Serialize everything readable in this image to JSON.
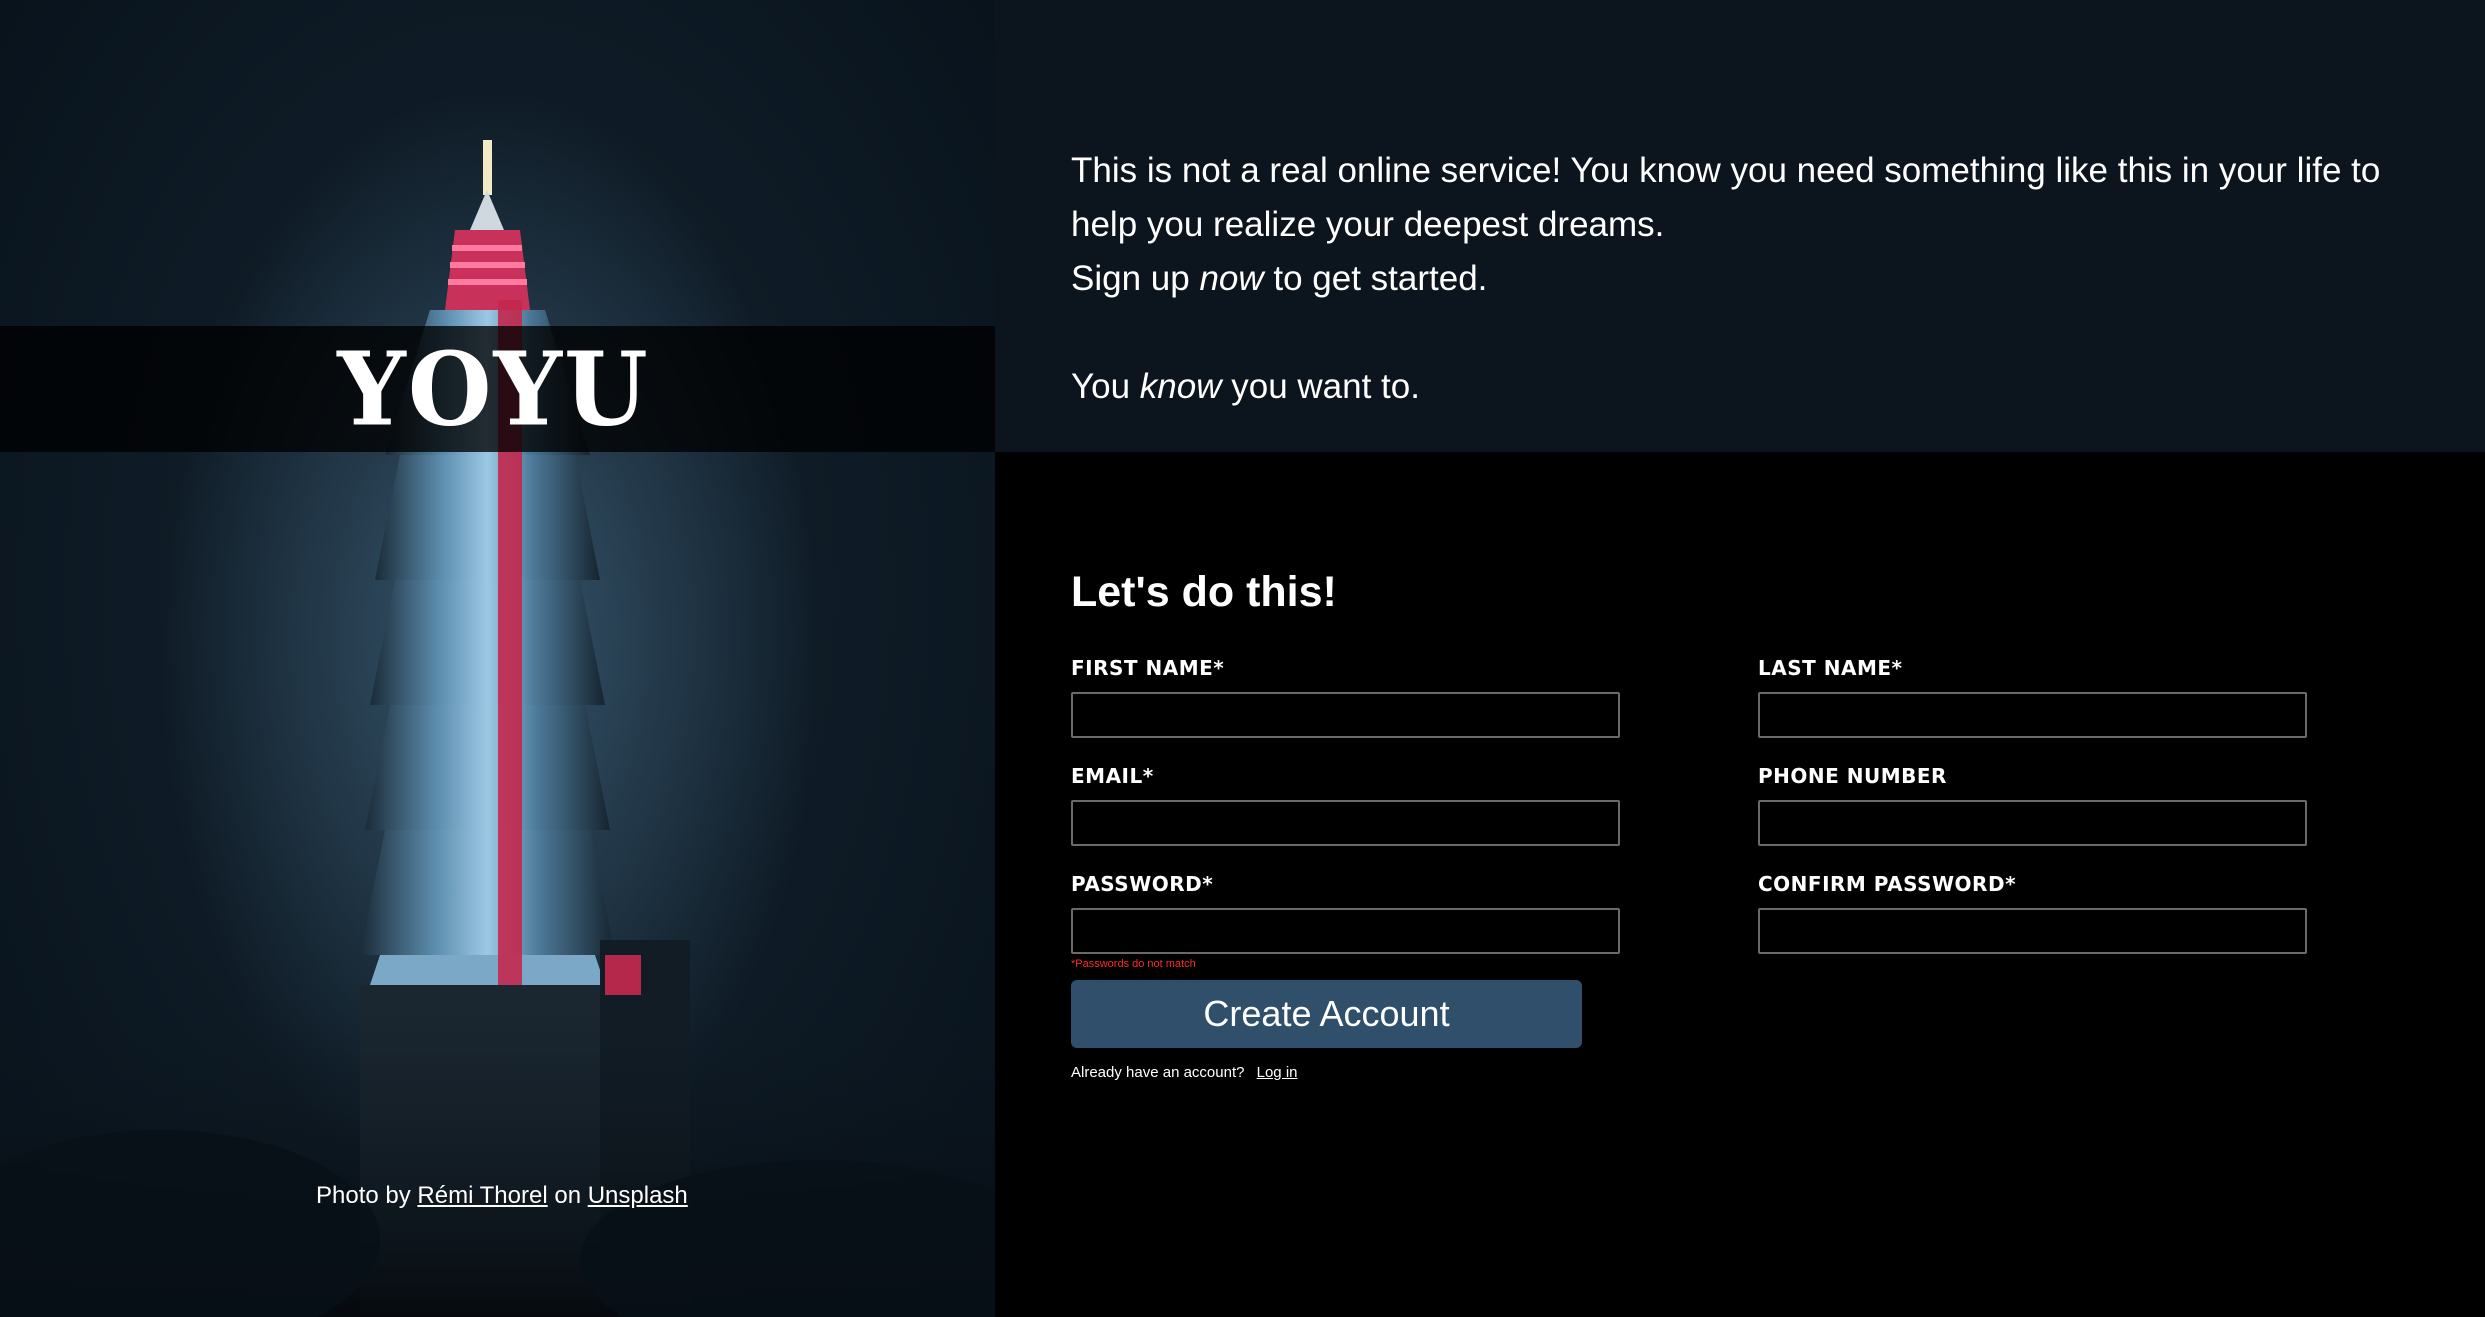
{
  "brand": {
    "logo_text": "YOYU"
  },
  "photo_credit": {
    "prefix": "Photo by ",
    "author": "Rémi Thorel",
    "middle": " on ",
    "site": "Unsplash"
  },
  "intro": {
    "line1": "This is not a real online service! You know you need something like this in your life to help you realize your deepest dreams.",
    "line2_before": "Sign up ",
    "line2_emph": "now",
    "line2_after": " to get started.",
    "line3_before": "You ",
    "line3_emph": "know",
    "line3_after": " you want to."
  },
  "form": {
    "title": "Let's do this!",
    "fields": {
      "first_name": {
        "label": "FIRST NAME*",
        "value": ""
      },
      "last_name": {
        "label": "LAST NAME*",
        "value": ""
      },
      "email": {
        "label": "EMAIL*",
        "value": ""
      },
      "phone": {
        "label": "PHONE NUMBER",
        "value": ""
      },
      "password": {
        "label": "PASSWORD*",
        "value": ""
      },
      "confirm_password": {
        "label": "CONFIRM PASSWORD*",
        "value": ""
      }
    },
    "password_error": "*Passwords do not match",
    "submit_label": "Create Account",
    "login_prompt": "Already have an account?",
    "login_link": "Log in"
  },
  "colors": {
    "intro_bg": "#0c151d",
    "form_bg": "#000000",
    "button_bg": "#2f4f6b",
    "error": "#ff2a2a",
    "input_border": "#6a6a6a"
  }
}
